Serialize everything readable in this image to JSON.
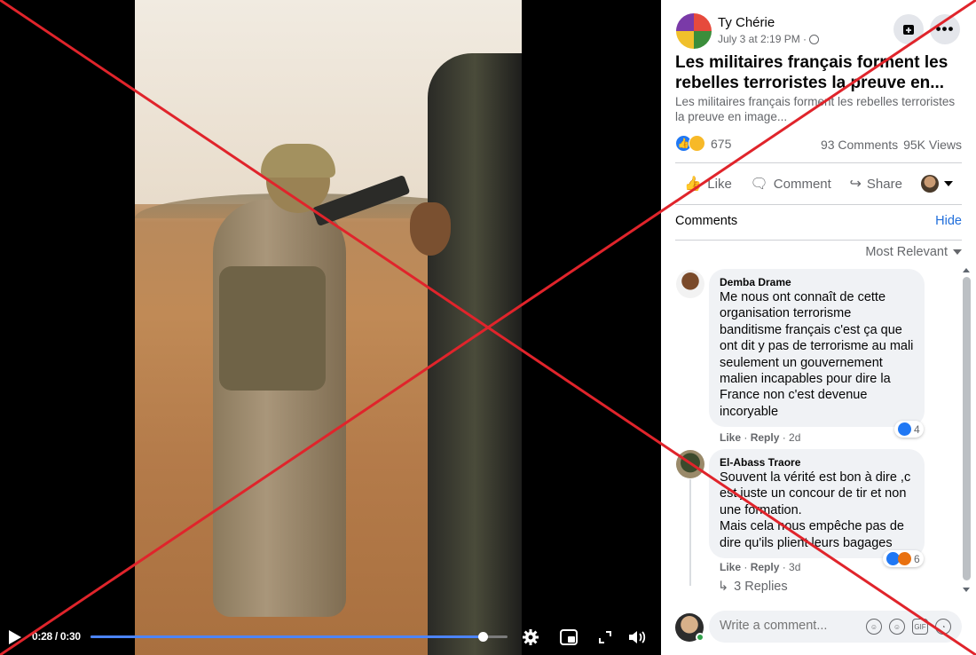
{
  "video": {
    "time": "0:28 / 0:30",
    "progress": 0.94,
    "icons": [
      "play-icon",
      "settings-icon",
      "miniplayer-icon",
      "fullscreen-icon",
      "volume-icon"
    ]
  },
  "overlay": {
    "mark": "red-x",
    "color": "#e0242b"
  },
  "post": {
    "author": "Ty Chérie",
    "date": "July 3 at 2:19 PM ·",
    "title": "Les militaires français forment les rebelles terroristes la preuve en...",
    "description": "Les militaires français forment les rebelles terroristes la preuve en image...",
    "reaction_count": "675",
    "comments_count": "93 Comments",
    "views": "95K Views"
  },
  "actions": {
    "like": "Like",
    "comment": "Comment",
    "share": "Share"
  },
  "comments_section": {
    "heading": "Comments",
    "hide": "Hide",
    "sort": "Most Relevant"
  },
  "comments": [
    {
      "name": "Demba Drame",
      "text": "Me nous ont connaît de cette organisation terrorisme banditisme français c'est ça que ont dit y pas de terrorisme au mali seulement un gouvernement malien incapables pour dire la France non c'est devenue incoryable",
      "like": "Like",
      "reply": "Reply",
      "time": "2d",
      "reactions": "4"
    },
    {
      "name": "El-Abass Traore",
      "text": "Souvent la vérité est bon à dire ,c est juste un concour de tir et non une formation.\nMais cela nous empêche pas de dire qu'ils plient leurs bagages",
      "like": "Like",
      "reply": "Reply",
      "time": "3d",
      "reactions": "6",
      "replies": "3 Replies"
    }
  ],
  "composer": {
    "placeholder": "Write a comment..."
  },
  "colors": {
    "accent": "#216fdb",
    "like_blue": "#2078f4",
    "progress": "#4c84ff"
  }
}
